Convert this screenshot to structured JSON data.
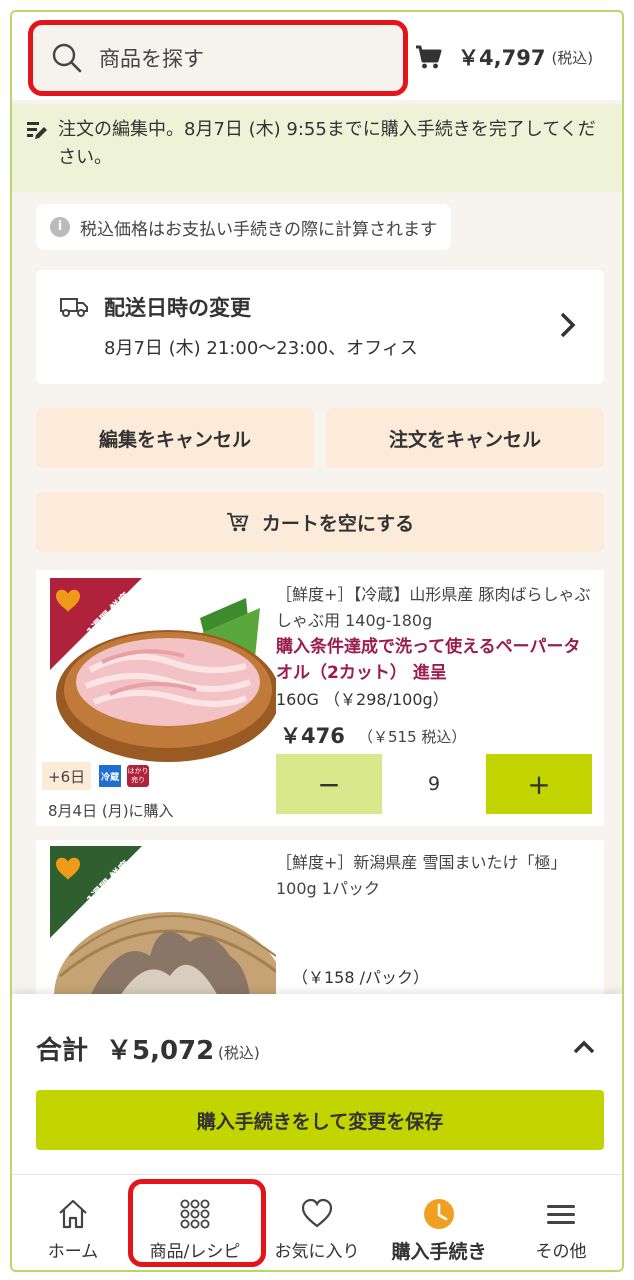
{
  "header": {
    "search_placeholder": "商品を探す",
    "cart_amount": "￥4,797",
    "cart_tax": "(税込)"
  },
  "notice": {
    "text": "注文の編集中。8月7日 (木) 9:55までに購入手続きを完了してください。"
  },
  "info": {
    "text": "税込価格はお支払い手続きの際に計算されます",
    "icon_char": "i"
  },
  "delivery": {
    "title": "配送日時の変更",
    "detail": "8月7日 (木) 21:00〜23:00、オフィス"
  },
  "actions": {
    "cancel_edit": "編集をキャンセル",
    "cancel_order": "注文をキャンセル",
    "empty_cart": "カートを空にする"
  },
  "products": [
    {
      "name": "［鮮度+］【冷蔵】山形県産 豚肉ばらしゃぶしゃぶ用 140g-180g",
      "promo": "購入条件達成で洗って使えるペーパータオル（2カット） 進呈",
      "weight": "160G （￥298/100g）",
      "price": "￥476",
      "price_tax": "（￥515 税込）",
      "qty": "9",
      "minus": "−",
      "plus": "+",
      "days_tag": "+6日",
      "cold_tag": "冷蔵",
      "weigh_tag": "はかり売り",
      "bought": "8月4日 (月)に購入",
      "badge": "1週間 鮮度保証"
    },
    {
      "name": "［鮮度+］新潟県産 雪国まいたけ「極」100g 1パック",
      "unit_price": "（￥158 /パック）",
      "badge": "1週間 鮮度保証"
    }
  ],
  "summary": {
    "total_label": "合計",
    "total_amount": "￥5,072",
    "total_tax": "(税込)",
    "checkout_label": "購入手続きをして変更を保存"
  },
  "nav": {
    "items": [
      {
        "label": "ホーム",
        "icon": "home-icon"
      },
      {
        "label": "商品/レシピ",
        "icon": "grid-dots-icon"
      },
      {
        "label": "お気に入り",
        "icon": "heart-icon"
      },
      {
        "label": "購入手続き",
        "icon": "clock-icon",
        "active": true
      },
      {
        "label": "その他",
        "icon": "menu-icon"
      }
    ]
  },
  "colors": {
    "accent_green": "#c3d500",
    "light_green": "#d8e88a",
    "notice_bg": "#eef3d7",
    "peach": "#fcebd9",
    "promo_red": "#9b1c4e",
    "highlight_red": "#e4141b",
    "active_orange": "#f0a020"
  }
}
